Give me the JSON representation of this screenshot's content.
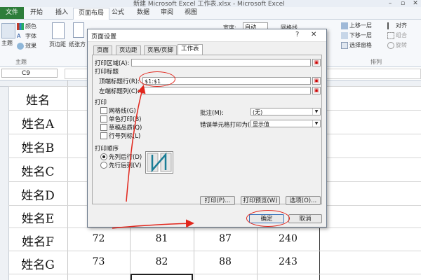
{
  "window": {
    "title": "新建 Microsoft Excel 工作表.xlsx - Microsoft Excel",
    "btn_min": "–",
    "btn_restore": "▫",
    "btn_close": "✕"
  },
  "ribbon": {
    "tabs": [
      "文件",
      "开始",
      "插入",
      "页面布局",
      "公式",
      "数据",
      "审阅",
      "视图"
    ],
    "active_tab": "页面布局",
    "left": {
      "theme": "主题",
      "color": "颜色",
      "font": "字体",
      "effect": "效果",
      "group": "主题",
      "margin": "页边距",
      "orientation": "纸张方"
    },
    "right": {
      "width_label": "宽度:",
      "width_value": "自动",
      "bring_forward": "上移一层",
      "send_backward": "下移一层",
      "selection_pane": "选择窗格",
      "align": "对齐",
      "group": "组合",
      "rotate": "旋转",
      "arrange": "排列"
    },
    "lookup": "网格线"
  },
  "formula_bar": {
    "name_box": "C9"
  },
  "sheet": {
    "rows": [
      {
        "name": "姓名",
        "values": []
      },
      {
        "name": "姓名A",
        "values": []
      },
      {
        "name": "姓名B",
        "values": []
      },
      {
        "name": "姓名C",
        "values": []
      },
      {
        "name": "姓名D",
        "values": []
      },
      {
        "name": "姓名E",
        "values": []
      },
      {
        "name": "姓名F",
        "values": [
          "72",
          "81",
          "87",
          "240"
        ]
      },
      {
        "name": "姓名G",
        "values": [
          "73",
          "82",
          "88",
          "243"
        ]
      }
    ]
  },
  "dialog": {
    "title": "页面设置",
    "help": "?",
    "close": "✕",
    "tabs": [
      "页面",
      "页边距",
      "页眉/页脚",
      "工作表"
    ],
    "active_tab": "工作表",
    "print_area_label": "打印区域(A):",
    "print_titles_label": "打印标题",
    "top_rows_label": "顶端标题行(R):",
    "top_rows_value": "$1:$1",
    "left_cols_label": "左端标题列(C):",
    "left_cols_value": "",
    "print_label": "打印",
    "checkboxes": [
      "网格线(G)",
      "单色打印(B)",
      "草稿品质(Q)",
      "行号列标(L)"
    ],
    "comments_label": "批注(M):",
    "comments_value": "(无)",
    "errors_label": "错误单元格打印为(E):",
    "errors_value": "显示值",
    "order_label": "打印顺序",
    "order_options": [
      "先列后行(D)",
      "先行后列(V)"
    ],
    "order_selected": "先列后行(D)",
    "btn_print": "打印(P)...",
    "btn_preview": "打印预览(W)",
    "btn_options": "选项(O)...",
    "btn_ok": "确定",
    "btn_cancel": "取消"
  },
  "colors": {
    "accent_green": "#2d7d3a",
    "annotation_red": "#e1261c",
    "dialog_bg": "#f0f0f0"
  }
}
